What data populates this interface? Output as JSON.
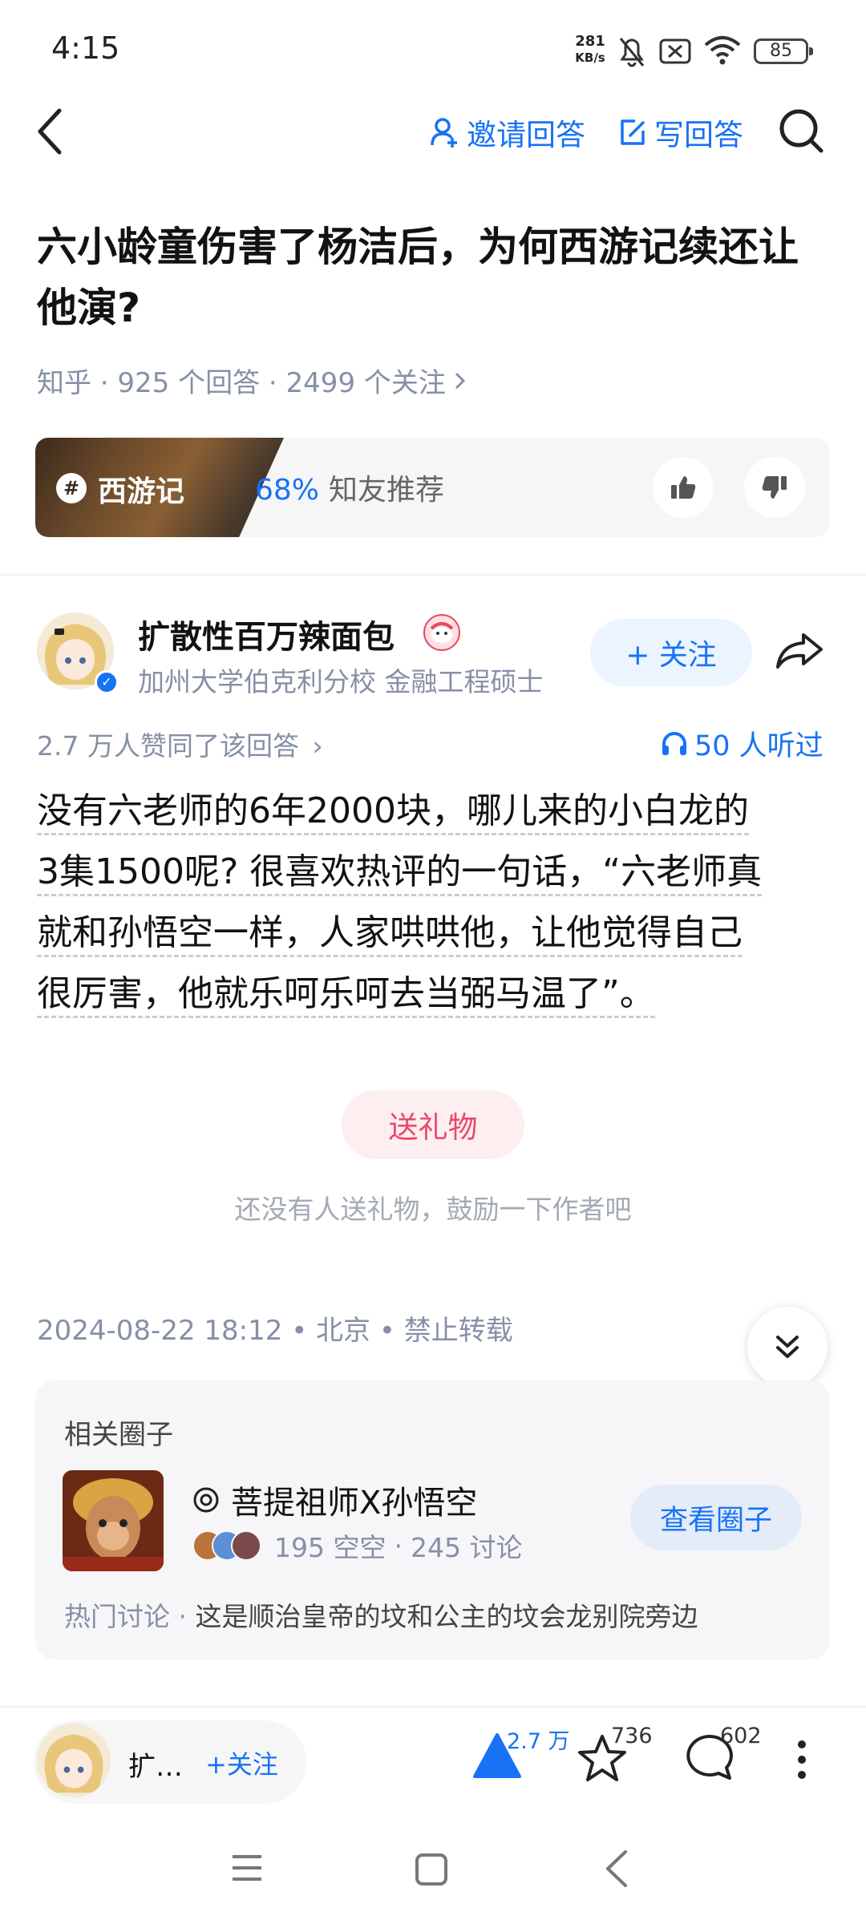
{
  "status_bar": {
    "time": "4:15",
    "net_speed_value": "281",
    "net_speed_unit": "KB/s",
    "battery": "85"
  },
  "nav": {
    "invite_label": "邀请回答",
    "write_label": "写回答"
  },
  "question": {
    "title": "六小龄童伤害了杨洁后，为何西游记续还让他演?",
    "meta": "知乎 · 925 个回答 · 2499 个关注"
  },
  "recommend": {
    "topic": "西游记",
    "percent": "68%",
    "label": "知友推荐"
  },
  "author": {
    "name": "扩散性百万辣面包",
    "bio": "加州大学伯克利分校 金融工程硕士",
    "follow_label": "+ 关注",
    "agree_text": "2.7 万人赞同了该回答",
    "listened": "50 人听过"
  },
  "answer": {
    "lines": [
      "没有六老师的6年2000块，哪儿来的小白龙的",
      "3集1500呢? 很喜欢热评的一句话，“六老师真",
      "就和孙悟空一样，人家哄哄他，让他觉得自己",
      "很厉害，他就乐呵乐呵去当弼马温了”。"
    ]
  },
  "gift": {
    "button": "送礼物",
    "hint": "还没有人送礼物，鼓励一下作者吧"
  },
  "post_meta": "2024-08-22 18:12 • 北京 • 禁止转载",
  "circle": {
    "heading": "相关圈子",
    "name": "菩提祖师X孙悟空",
    "members": "195 空空",
    "discussions": "245 讨论",
    "view_button": "查看圈子",
    "hot_label": "热门讨论",
    "hot_text": "这是顺治皇帝的坟和公主的坟会龙别院旁边"
  },
  "bottom_bar": {
    "author_short": "扩…",
    "follow": "+关注",
    "votes": "2.7 万",
    "favorites": "736",
    "comments": "602"
  },
  "colors": {
    "accent": "#1772f6",
    "gift_red": "#e84a6b",
    "meta_gray": "#8590a6"
  }
}
